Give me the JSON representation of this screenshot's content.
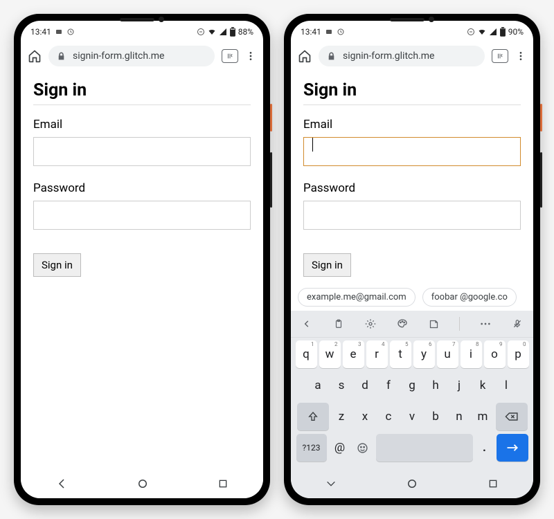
{
  "left": {
    "status": {
      "time": "13:41",
      "battery": "88%"
    },
    "url": "signin-form.glitch.me",
    "page": {
      "title": "Sign in",
      "email_label": "Email",
      "email_value": "",
      "password_label": "Password",
      "password_value": "",
      "submit_label": "Sign in"
    }
  },
  "right": {
    "status": {
      "time": "13:41",
      "battery": "90%"
    },
    "url": "signin-form.glitch.me",
    "page": {
      "title": "Sign in",
      "email_label": "Email",
      "email_value": "",
      "password_label": "Password",
      "password_value": "",
      "submit_label": "Sign in"
    },
    "suggestions": [
      "example.me@gmail.com",
      "foobar @google.co"
    ],
    "keyboard": {
      "row1": [
        {
          "k": "q",
          "h": "1"
        },
        {
          "k": "w",
          "h": "2"
        },
        {
          "k": "e",
          "h": "3"
        },
        {
          "k": "r",
          "h": "4"
        },
        {
          "k": "t",
          "h": "5"
        },
        {
          "k": "y",
          "h": "6"
        },
        {
          "k": "u",
          "h": "7"
        },
        {
          "k": "i",
          "h": "8"
        },
        {
          "k": "o",
          "h": "9"
        },
        {
          "k": "p",
          "h": "0"
        }
      ],
      "row2": [
        "a",
        "s",
        "d",
        "f",
        "g",
        "h",
        "j",
        "k",
        "l"
      ],
      "row3": [
        "z",
        "x",
        "c",
        "v",
        "b",
        "n",
        "m"
      ],
      "bottom": {
        "numkey": "?123",
        "at": "@",
        "dot": "."
      }
    }
  }
}
